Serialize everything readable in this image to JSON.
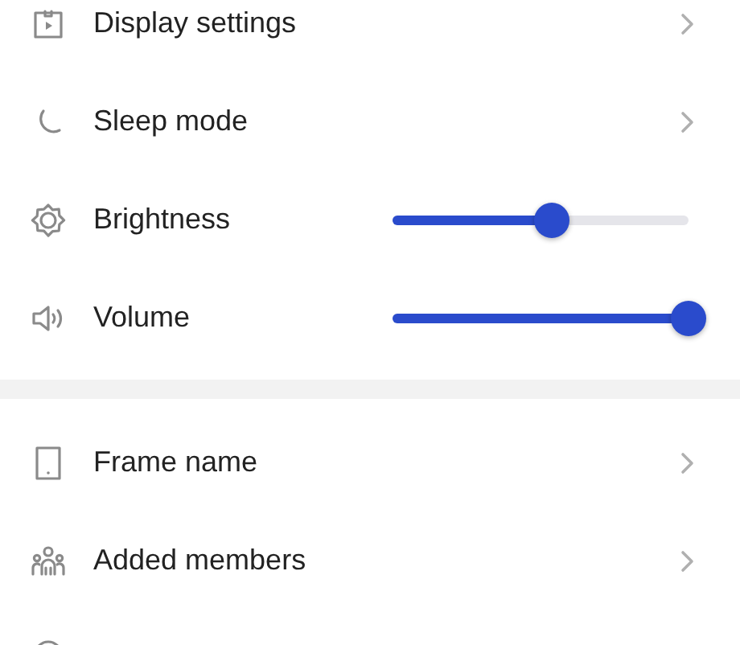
{
  "groups": [
    {
      "items": [
        {
          "kind": "display",
          "label": "Display settings"
        },
        {
          "kind": "moon",
          "label": "Sleep mode"
        },
        {
          "kind": "sun",
          "label": "Brightness",
          "level": 0.54
        },
        {
          "kind": "speaker",
          "label": "Volume",
          "level": 1
        }
      ]
    },
    {
      "items": [
        {
          "kind": "frame",
          "label": "Frame name"
        },
        {
          "kind": "people",
          "label": "Added members"
        },
        {
          "kind": "circle"
        }
      ]
    }
  ]
}
